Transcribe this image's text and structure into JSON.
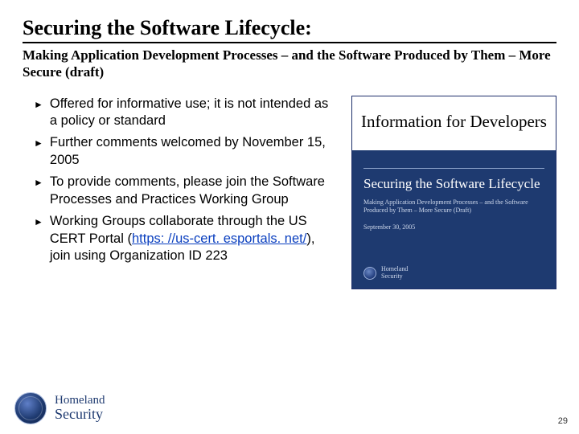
{
  "title": "Securing the Software Lifecycle:",
  "subtitle": "Making Application Development Processes – and the Software Produced by Them – More Secure  (draft)",
  "bullets": [
    {
      "text": "Offered for informative use; it is not intended as a policy or standard"
    },
    {
      "text": "Further comments welcomed by November 15, 2005"
    },
    {
      "text": "To provide comments, please join the Software Processes and Practices Working Group"
    },
    {
      "pre": "Working Groups collaborate through the US CERT Portal (",
      "link": "https: //us-cert. esportals. net/",
      "post": "), join using Organization ID 223"
    }
  ],
  "panel": {
    "heading": "Information for Developers",
    "cover": {
      "title": "Securing the Software Lifecycle",
      "sub": "Making Application Development Processes – and the Software Produced by Them – More Secure (Draft)",
      "date": "September 30, 2005",
      "org_l1": "Homeland",
      "org_l2": "Security"
    }
  },
  "footer": {
    "org_l1": "Homeland",
    "org_l2": "Security"
  },
  "page_number": "29"
}
